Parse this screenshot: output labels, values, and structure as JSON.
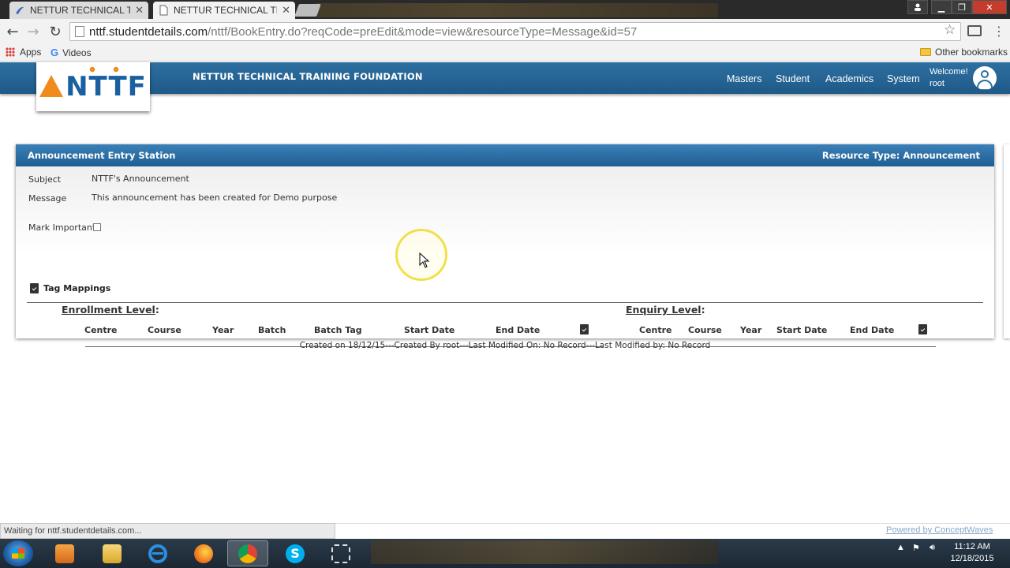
{
  "browser": {
    "tabs": [
      {
        "title": "NETTUR TECHNICAL TRAI",
        "active": false
      },
      {
        "title": "NETTUR TECHNICAL TRAI",
        "active": true
      }
    ],
    "url_host": "nttf.studentdetails.com",
    "url_path": "/nttf/BookEntry.do?reqCode=preEdit&mode=view&resourceType=Message&id=57",
    "bookmarks": {
      "apps": "Apps",
      "videos": "Videos",
      "other": "Other bookmarks"
    },
    "status": "Waiting for nttf.studentdetails.com..."
  },
  "header": {
    "logo_text": "NTTF",
    "org_name": "NETTUR TECHNICAL TRAINING FOUNDATION",
    "nav": [
      "Masters",
      "Student",
      "Academics",
      "System"
    ],
    "welcome": "Welcome!",
    "user": "root"
  },
  "panel": {
    "title": "Announcement Entry Station",
    "resource_type": "Resource Type: Announcement",
    "subject_label": "Subject",
    "subject_value": "NTTF's Announcement",
    "message_label": "Message",
    "message_value": "This announcement has been created for Demo purpose",
    "mark_important_label": "Mark Important",
    "tag_mappings": "Tag Mappings",
    "enrollment": {
      "title": "Enrollment Level",
      "colon": ":",
      "columns": [
        "Centre",
        "Course",
        "Year",
        "Batch",
        "Batch Tag",
        "Start Date",
        "End Date"
      ]
    },
    "enquiry": {
      "title": "Enquiry Level",
      "colon": ":",
      "columns": [
        "Centre",
        "Course",
        "Year",
        "Start Date",
        "End Date"
      ]
    }
  },
  "footer_note": "Created on 18/12/15---Created By root---Last Modified On: No Record---Last Modified by: No Record",
  "powered_by": "Powered by ConceptWaves",
  "taskbar": {
    "time": "11:12 AM",
    "date": "12/18/2015"
  },
  "colors": {
    "header_blue": "#1f5a88",
    "logo_orange": "#f08c1e"
  }
}
